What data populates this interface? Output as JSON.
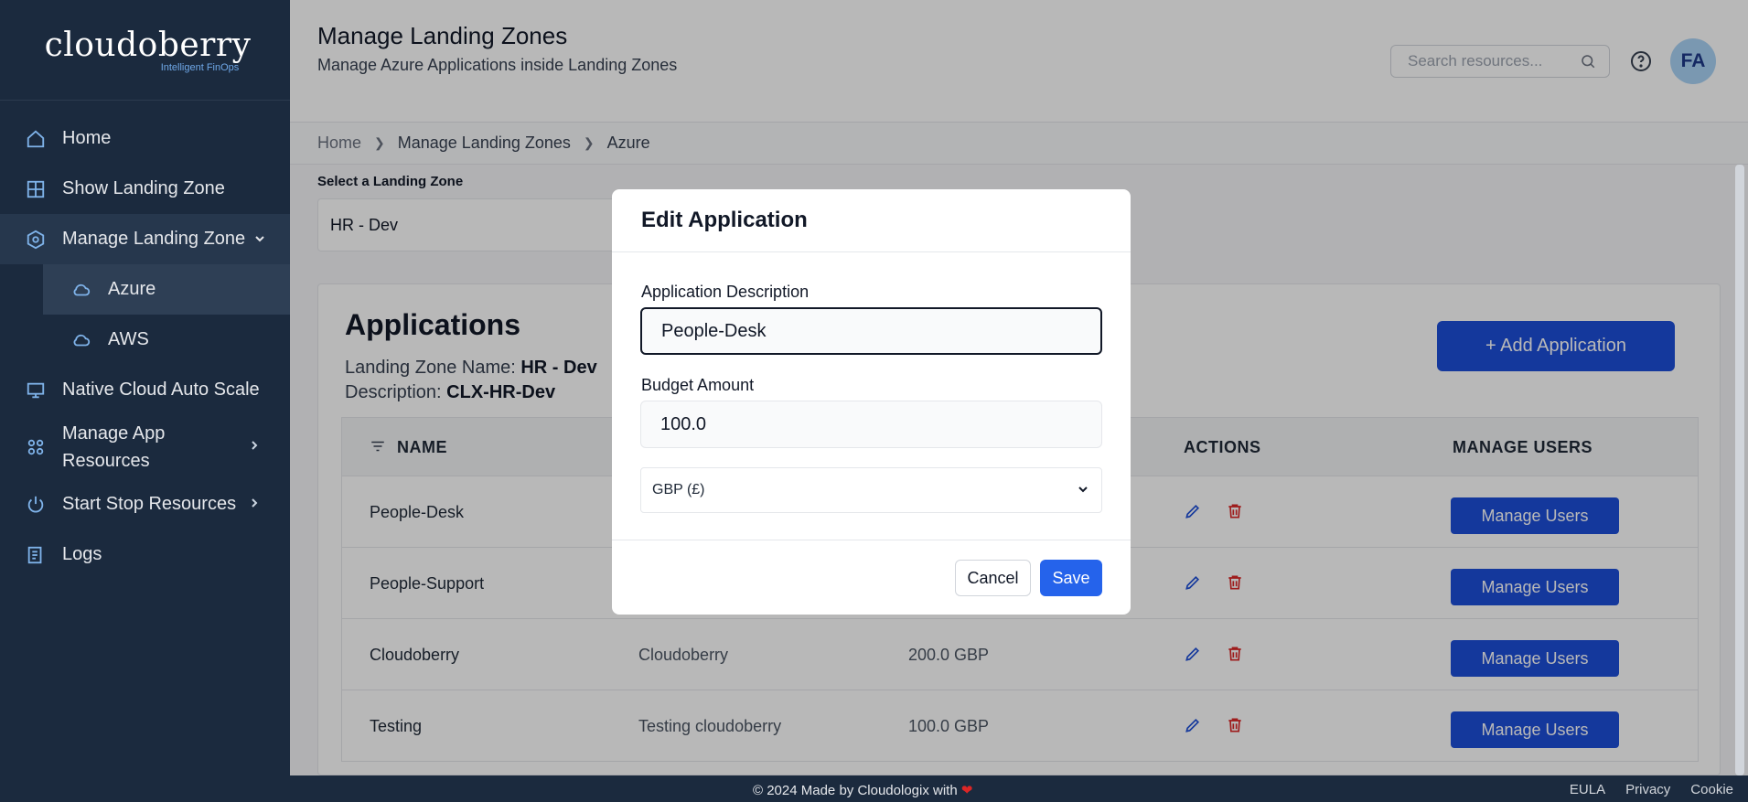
{
  "brand": {
    "name": "cloudoberry",
    "tagline": "Intelligent FinOps"
  },
  "sidebar": {
    "items": [
      {
        "label": "Home",
        "icon": "home-icon"
      },
      {
        "label": "Show Landing Zone",
        "icon": "grid-icon"
      },
      {
        "label": "Manage Landing Zone",
        "icon": "settings-hex-icon",
        "expanded": true
      },
      {
        "label": "Azure",
        "icon": "cloud-icon",
        "sub": true,
        "active": true
      },
      {
        "label": "AWS",
        "icon": "cloud-icon",
        "sub": true
      },
      {
        "label": "Native Cloud Auto Scale",
        "icon": "monitor-icon"
      },
      {
        "label": "Manage App Resources",
        "icon": "apps-icon"
      },
      {
        "label": "Start Stop Resources",
        "icon": "power-icon"
      },
      {
        "label": "Logs",
        "icon": "logs-icon"
      }
    ]
  },
  "header": {
    "title": "Manage Landing Zones",
    "subtitle": "Manage Azure Applications inside Landing Zones",
    "search_placeholder": "Search resources...",
    "avatar_initials": "FA"
  },
  "breadcrumb": [
    "Home",
    "Manage Landing Zones",
    "Azure"
  ],
  "landing_zone": {
    "label": "Select a Landing Zone",
    "selected": "HR - Dev"
  },
  "applications": {
    "title": "Applications",
    "lz_name_label": "Landing Zone Name:",
    "lz_name_value": "HR - Dev",
    "description_label": "Description:",
    "description_value": "CLX-HR-Dev",
    "add_button": "+ Add Application",
    "columns": {
      "name": "NAME",
      "actions": "ACTIONS",
      "manage_users": "MANAGE USERS"
    },
    "rows": [
      {
        "name": "People-Desk",
        "description": "",
        "budget": ""
      },
      {
        "name": "People-Support",
        "description": "",
        "budget": ""
      },
      {
        "name": "Cloudoberry",
        "description": "Cloudoberry",
        "budget": "200.0 GBP"
      },
      {
        "name": "Testing",
        "description": "Testing cloudoberry",
        "budget": "100.0 GBP"
      }
    ],
    "manage_users_label": "Manage Users"
  },
  "modal": {
    "title": "Edit Application",
    "description_label": "Application Description",
    "description_value": "People-Desk",
    "budget_label": "Budget Amount",
    "budget_value": "100.0",
    "currency": "GBP (£)",
    "cancel": "Cancel",
    "save": "Save"
  },
  "footer": {
    "copyright": "© 2024 Made by Cloudologix with",
    "links": [
      "EULA",
      "Privacy",
      "Cookie"
    ]
  },
  "colors": {
    "sidebar": "#1b2a3e",
    "primary": "#1d4ed8",
    "danger": "#dc2626"
  }
}
